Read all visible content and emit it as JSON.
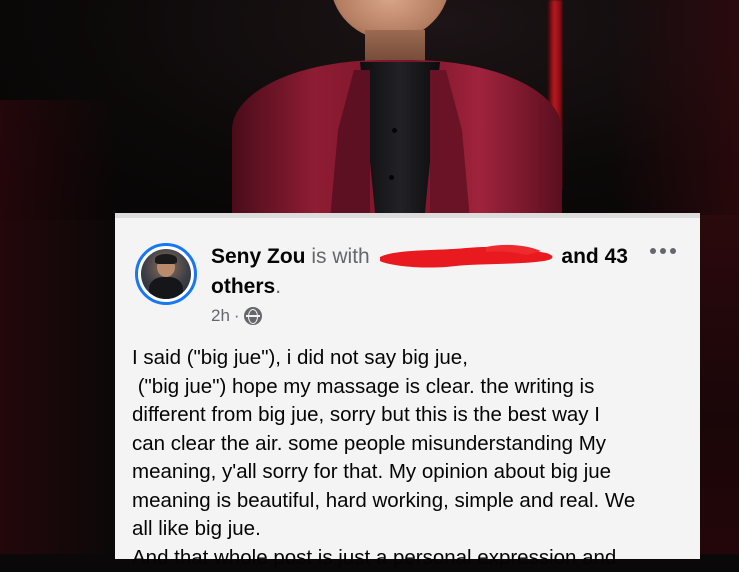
{
  "post": {
    "author": "Seny Zou",
    "with_text": "is with",
    "with_suffix": "and 43",
    "others": "others",
    "period": ".",
    "time": "2h",
    "separator": "·",
    "privacy_icon": "globe-icon",
    "menu_icon": "more-options-icon",
    "lines": [
      "I said (\"big jue\"), i did not say big jue,",
      " (\"big jue\") hope my massage is clear. the writing is",
      "different from big jue, sorry but this is the best way I",
      "can clear the air. some people misunderstanding My",
      "meaning, y'all sorry for that. My opinion about big jue",
      "meaning is beautiful, hard working, simple and real. We",
      "all like big jue.",
      "And that whole post is just a personal expression and"
    ]
  },
  "colors": {
    "accent": "#1877f2",
    "card_bg": "#f4f4f4",
    "secondary_text": "#65676b",
    "redaction": "#e8191f",
    "jacket": "#8e1c33"
  }
}
